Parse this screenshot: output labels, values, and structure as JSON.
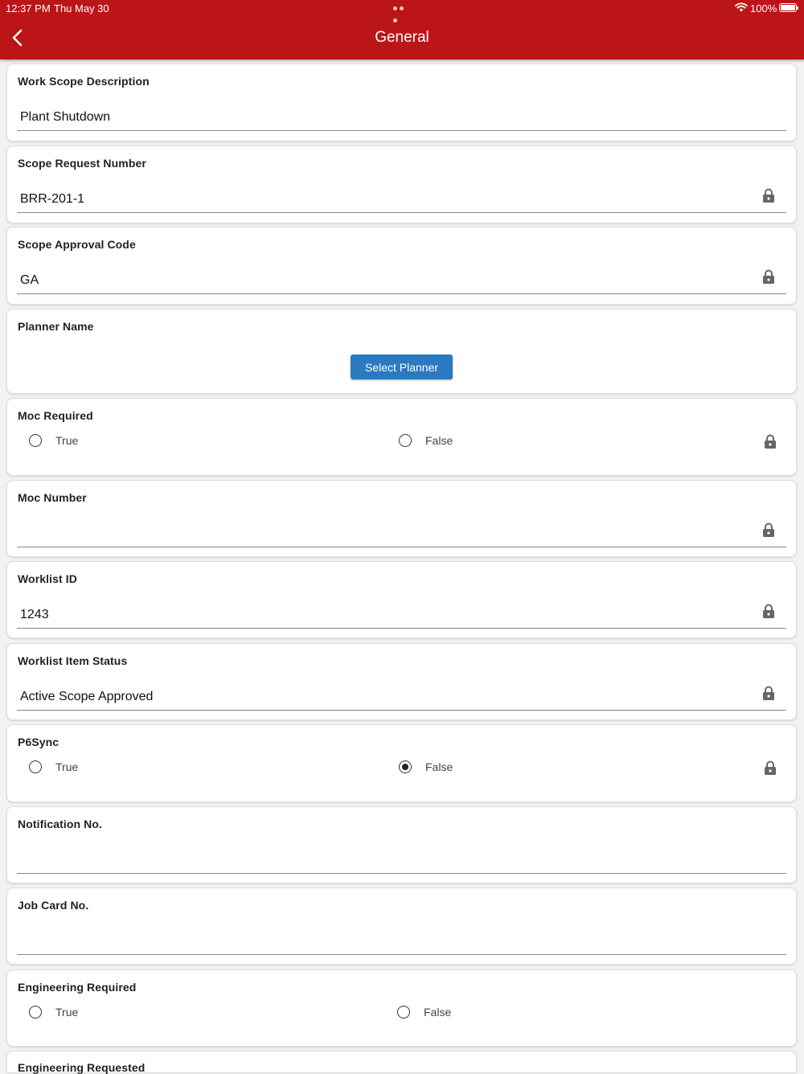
{
  "status_bar": {
    "time": "12:37 PM",
    "date": "Thu May 30",
    "battery": "100%"
  },
  "header": {
    "title": "General"
  },
  "fields": {
    "work_scope_description": {
      "label": "Work Scope Description",
      "value": "Plant Shutdown"
    },
    "scope_request_number": {
      "label": "Scope Request Number",
      "value": "BRR-201-1"
    },
    "scope_approval_code": {
      "label": "Scope Approval Code",
      "value": "GA"
    },
    "planner_name": {
      "label": "Planner Name",
      "button": "Select Planner"
    },
    "moc_required": {
      "label": "Moc Required",
      "option_true": "True",
      "option_false": "False",
      "selected": null
    },
    "moc_number": {
      "label": "Moc Number",
      "value": ""
    },
    "worklist_id": {
      "label": "Worklist ID",
      "value": "1243"
    },
    "worklist_item_status": {
      "label": "Worklist Item Status",
      "value": "Active Scope Approved"
    },
    "p6sync": {
      "label": "P6Sync",
      "option_true": "True",
      "option_false": "False",
      "selected": "False"
    },
    "notification_no": {
      "label": "Notification No.",
      "value": ""
    },
    "job_card_no": {
      "label": "Job Card No.",
      "value": ""
    },
    "engineering_required": {
      "label": "Engineering Required",
      "option_true": "True",
      "option_false": "False",
      "selected": null
    },
    "engineering_requested": {
      "label": "Engineering Requested"
    }
  },
  "colors": {
    "header": "#bb1518",
    "button": "#2b7ac0"
  }
}
